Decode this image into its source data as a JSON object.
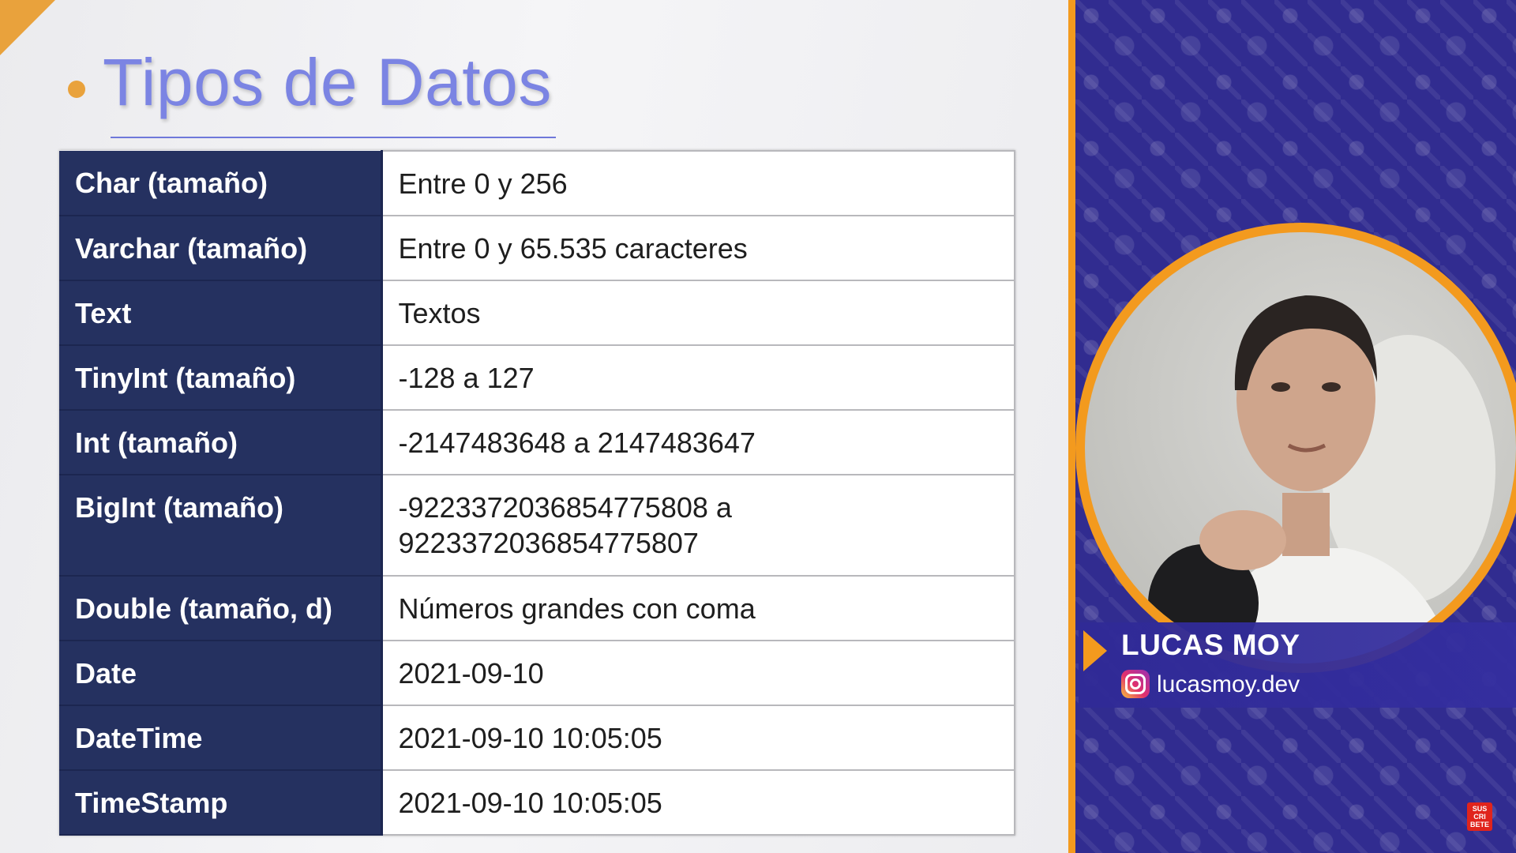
{
  "slide": {
    "title": "Tipos de Datos",
    "rows": [
      {
        "type": "Char (tamaño)",
        "desc": "Entre 0 y 256"
      },
      {
        "type": "Varchar (tamaño)",
        "desc": "Entre 0 y 65.535 caracteres"
      },
      {
        "type": "Text",
        "desc": "Textos"
      },
      {
        "type": "TinyInt (tamaño)",
        "desc": "-128 a 127"
      },
      {
        "type": "Int (tamaño)",
        "desc": "-2147483648 a 2147483647"
      },
      {
        "type": "BigInt (tamaño)",
        "desc": "-9223372036854775808 a 9223372036854775807"
      },
      {
        "type": "Double (tamaño, d)",
        "desc": "Números grandes con coma"
      },
      {
        "type": "Date",
        "desc": "2021-09-10"
      },
      {
        "type": "DateTime",
        "desc": "2021-09-10 10:05:05"
      },
      {
        "type": "TimeStamp",
        "desc": "2021-09-10 10:05:05"
      }
    ]
  },
  "presenter": {
    "name": "LUCAS MOY",
    "handle": "lucasmoy.dev",
    "handle_icon": "instagram-icon"
  },
  "subscribe_badge": {
    "label": "SUS CRI BETE",
    "icon": "subscribe-icon"
  },
  "colors": {
    "accent_orange": "#f39a1e",
    "title_blue": "#7b84e3",
    "table_navy": "#253160",
    "panel_purple": "#2e2a8a"
  }
}
